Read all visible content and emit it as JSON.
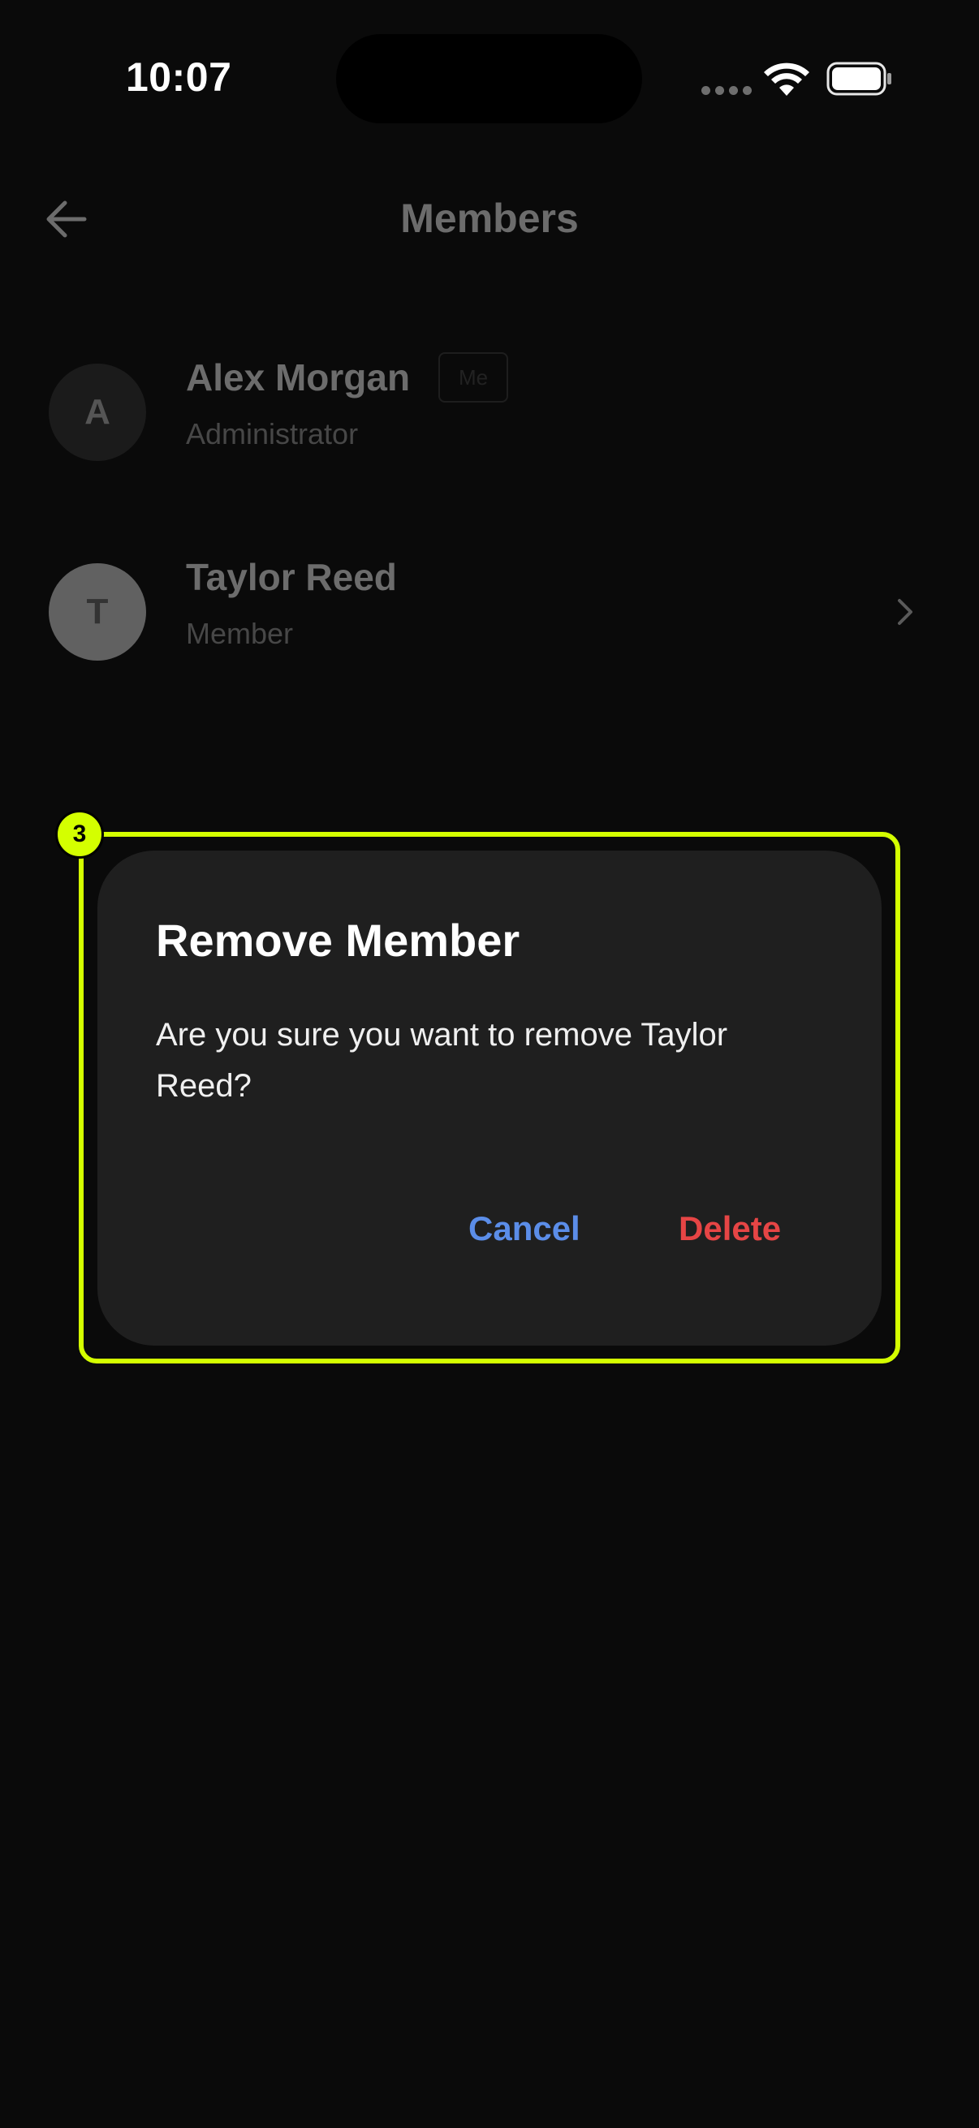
{
  "status_bar": {
    "time": "10:07"
  },
  "header": {
    "title": "Members",
    "back_icon": "arrow-left-icon"
  },
  "members": [
    {
      "initial": "A",
      "name": "Alex Morgan",
      "badge": "Me",
      "role": "Administrator"
    },
    {
      "initial": "T",
      "name": "Taylor Reed",
      "role": "Member",
      "trailing_icon": "chevron-right-icon"
    }
  ],
  "highlight": {
    "marker": "3",
    "color": "#d4ff00"
  },
  "dialog": {
    "title": "Remove Member",
    "message": "Are you sure you want to remove Taylor Reed?",
    "cancel_label": "Cancel",
    "delete_label": "Delete"
  },
  "colors": {
    "background": "#0a0a0a",
    "dialog": "#1f1f1f",
    "cancel": "#5b8de8",
    "delete": "#e64545"
  }
}
